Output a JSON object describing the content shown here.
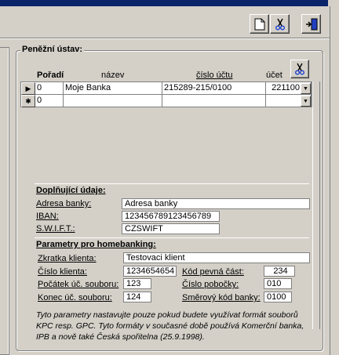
{
  "toolbar": {
    "new_icon": "new-document-icon",
    "cut_icon": "scissors-icon",
    "exit_icon": "exit-door-icon"
  },
  "group": {
    "title": "Peněžní ústav:"
  },
  "grid": {
    "headers": {
      "order": "Pořadí",
      "name": "název",
      "account": "číslo účtu",
      "ucet": "účet"
    },
    "rows": [
      {
        "order": "0",
        "name": "Moje Banka",
        "account": "215289-215/0100",
        "ucet": "221100"
      },
      {
        "order": "0",
        "name": "",
        "account": "",
        "ucet": ""
      }
    ],
    "current_row_marker": "▶",
    "new_row_marker": "✱"
  },
  "extra": {
    "title": "Doplňující údaje:",
    "address_label": "Adresa banky:",
    "address_value": "Adresa banky",
    "iban_label": "IBAN:",
    "iban_value": "123456789123456789",
    "swift_label": "S.W.I.F.T.:",
    "swift_value": "CZSWIFT"
  },
  "homebanking": {
    "title": "Parametry pro homebanking:",
    "client_abbr_label": "Zkratka klienta:",
    "client_abbr_value": "Testovaci klient",
    "client_no_label": "Číslo klienta:",
    "client_no_value": "1234654654",
    "fixed_code_label": "Kód pevná část:",
    "fixed_code_value": "234",
    "file_start_label": "Počátek úč. souboru:",
    "file_start_value": "123",
    "branch_label": "Číslo pobočky:",
    "branch_value": "010",
    "file_end_label": "Konec úč. souboru:",
    "file_end_value": "124",
    "bank_code_label": "Směrový kód banky:",
    "bank_code_value": "0100"
  },
  "note": "Tyto parametry nastavujte pouze pokud budete využívat formát souborů KPC resp. GPC. Tyto formáty v současné době používá Komerční banka, IPB a nově také Česká spořitelna (25.9.1998)."
}
